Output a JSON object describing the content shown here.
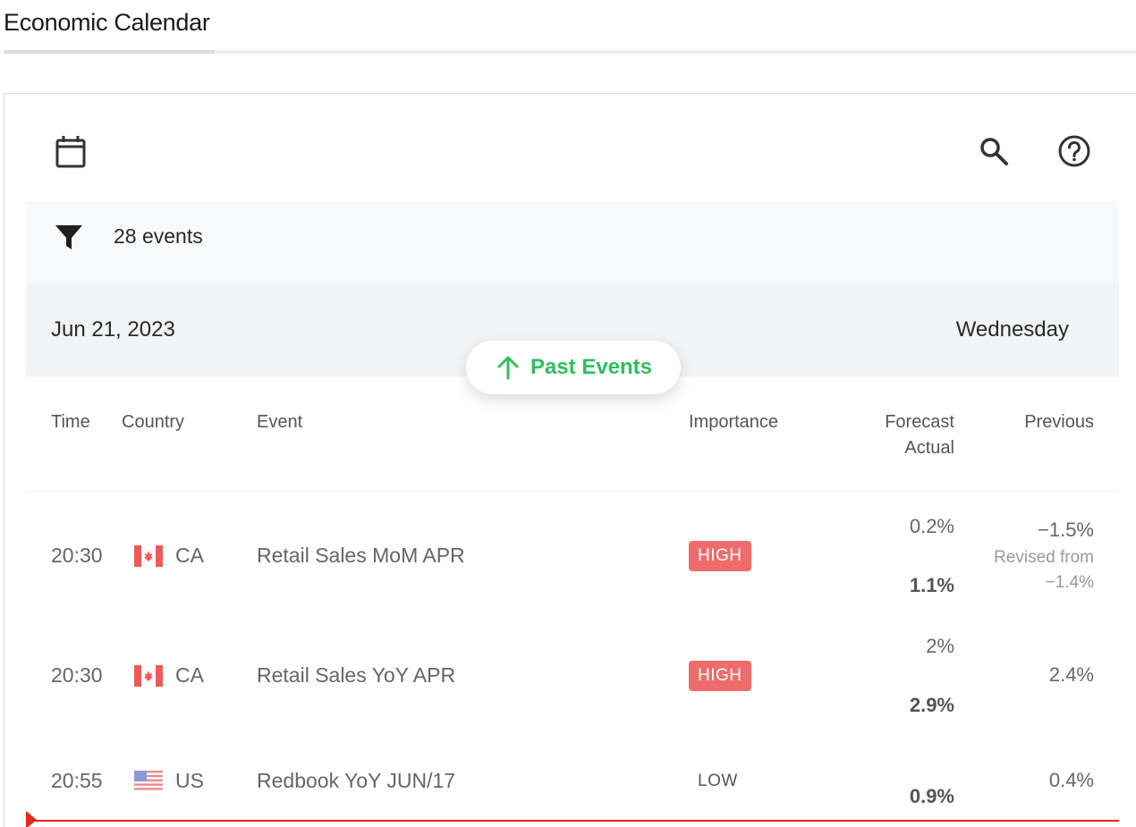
{
  "page": {
    "tab_title": "Economic Calendar"
  },
  "toolbar": {
    "calendar_icon": "calendar-icon",
    "search_icon": "search-icon",
    "help_icon": "help-circle-icon"
  },
  "filter": {
    "icon": "filter-funnel-icon",
    "events_count": "28 events"
  },
  "date_header": {
    "date": "Jun 21, 2023",
    "day": "Wednesday"
  },
  "past_events_button": {
    "label": "Past Events",
    "icon": "arrow-up-icon",
    "color": "#2fbf5e"
  },
  "table": {
    "headers": {
      "time": "Time",
      "country": "Country",
      "event": "Event",
      "importance": "Importance",
      "forecast": "Forecast",
      "actual": "Actual",
      "previous": "Previous"
    },
    "rows": [
      {
        "time": "20:30",
        "country": "CA",
        "flag": "canada-flag-icon",
        "event": "Retail Sales MoM APR",
        "importance": "HIGH",
        "forecast": "0.2%",
        "actual": "1.1%",
        "previous": "−1.5%",
        "revised_label": "Revised from",
        "revised_value": "−1.4%"
      },
      {
        "time": "20:30",
        "country": "CA",
        "flag": "canada-flag-icon",
        "event": "Retail Sales YoY APR",
        "importance": "HIGH",
        "forecast": "2%",
        "actual": "2.9%",
        "previous": "2.4%"
      },
      {
        "time": "20:55",
        "country": "US",
        "flag": "us-flag-icon",
        "event": "Redbook YoY JUN/17",
        "importance": "LOW",
        "forecast": "",
        "actual": "0.9%",
        "previous": "0.4%"
      }
    ]
  },
  "colors": {
    "high_badge": "#ee6c6c",
    "now_line": "#ee2222"
  }
}
